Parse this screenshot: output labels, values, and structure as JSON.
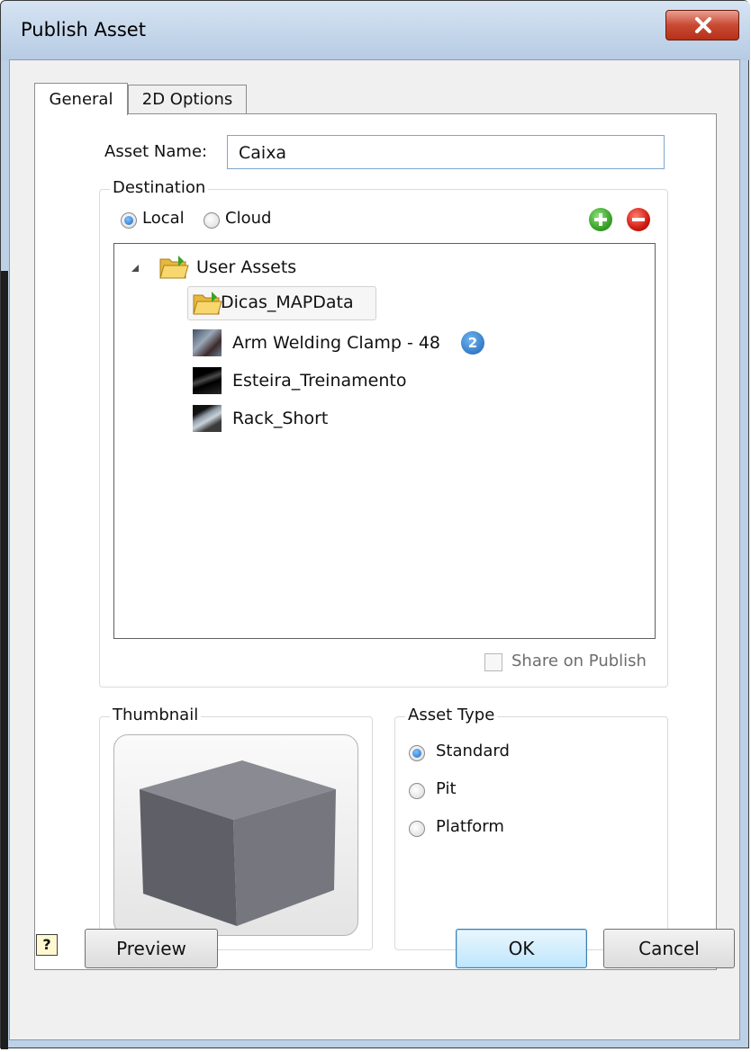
{
  "window": {
    "title": "Publish Asset"
  },
  "tabs": [
    {
      "label": "General",
      "active": true
    },
    {
      "label": "2D Options",
      "active": false
    }
  ],
  "asset_name": {
    "label": "Asset Name:",
    "value": "Caixa"
  },
  "destination": {
    "legend": "Destination",
    "options": [
      {
        "label": "Local",
        "checked": true
      },
      {
        "label": "Cloud",
        "checked": false
      }
    ],
    "add_icon": "add-circle-green",
    "remove_icon": "remove-circle-red",
    "tree": {
      "root": "User Assets",
      "items": [
        {
          "label": "Dicas_MAPData",
          "icon": "folder-icon",
          "selected": true
        },
        {
          "label": "Arm Welding Clamp - 48",
          "icon": "asset-thumbnail",
          "badge": "2"
        },
        {
          "label": "Esteira_Treinamento",
          "icon": "asset-thumbnail"
        },
        {
          "label": "Rack_Short",
          "icon": "asset-thumbnail"
        }
      ]
    },
    "share_on_publish": {
      "label": "Share on Publish",
      "checked": false,
      "enabled": false
    }
  },
  "thumbnail": {
    "legend": "Thumbnail",
    "image": "gray-cube"
  },
  "asset_type": {
    "legend": "Asset Type",
    "options": [
      {
        "label": "Standard",
        "checked": true
      },
      {
        "label": "Pit",
        "checked": false
      },
      {
        "label": "Platform",
        "checked": false
      }
    ]
  },
  "footer": {
    "help_label": "?",
    "preview_label": "Preview",
    "ok_label": "OK",
    "cancel_label": "Cancel"
  },
  "colors": {
    "title_bar": "#bcd0e6",
    "close_button": "#c84a33",
    "radio_selected": "#1c6bc4",
    "add_green": "#3aa22a",
    "remove_red": "#d01b12",
    "cube_gray": "#6e6e76"
  }
}
